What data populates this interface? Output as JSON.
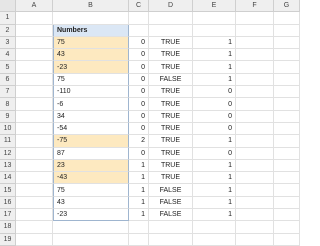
{
  "columns": [
    "A",
    "B",
    "C",
    "D",
    "E",
    "F",
    "G"
  ],
  "table_header": "Numbers",
  "rows": [
    {
      "num": "1",
      "b": "",
      "c": "",
      "d": "",
      "e": "",
      "hl": false
    },
    {
      "num": "2",
      "b": "Numbers",
      "c": "",
      "d": "",
      "e": "",
      "hl": false,
      "header": true
    },
    {
      "num": "3",
      "b": "75",
      "c": "0",
      "d": "TRUE",
      "e": "1",
      "hl": true
    },
    {
      "num": "4",
      "b": "43",
      "c": "0",
      "d": "TRUE",
      "e": "1",
      "hl": true
    },
    {
      "num": "5",
      "b": "-23",
      "c": "0",
      "d": "TRUE",
      "e": "1",
      "hl": true
    },
    {
      "num": "6",
      "b": "75",
      "c": "0",
      "d": "FALSE",
      "e": "1",
      "hl": false
    },
    {
      "num": "7",
      "b": "-110",
      "c": "0",
      "d": "TRUE",
      "e": "0",
      "hl": false
    },
    {
      "num": "8",
      "b": "-6",
      "c": "0",
      "d": "TRUE",
      "e": "0",
      "hl": false
    },
    {
      "num": "9",
      "b": "34",
      "c": "0",
      "d": "TRUE",
      "e": "0",
      "hl": false
    },
    {
      "num": "10",
      "b": "-54",
      "c": "0",
      "d": "TRUE",
      "e": "0",
      "hl": false
    },
    {
      "num": "11",
      "b": "-75",
      "c": "2",
      "d": "TRUE",
      "e": "1",
      "hl": true
    },
    {
      "num": "12",
      "b": "87",
      "c": "0",
      "d": "TRUE",
      "e": "0",
      "hl": false
    },
    {
      "num": "13",
      "b": "23",
      "c": "1",
      "d": "TRUE",
      "e": "1",
      "hl": true
    },
    {
      "num": "14",
      "b": "-43",
      "c": "1",
      "d": "TRUE",
      "e": "1",
      "hl": true
    },
    {
      "num": "15",
      "b": "75",
      "c": "1",
      "d": "FALSE",
      "e": "1",
      "hl": false
    },
    {
      "num": "16",
      "b": "43",
      "c": "1",
      "d": "FALSE",
      "e": "1",
      "hl": false
    },
    {
      "num": "17",
      "b": "-23",
      "c": "1",
      "d": "FALSE",
      "e": "1",
      "hl": false
    },
    {
      "num": "18",
      "b": "",
      "c": "",
      "d": "",
      "e": "",
      "hl": false
    },
    {
      "num": "19",
      "b": "",
      "c": "",
      "d": "",
      "e": "",
      "hl": false
    }
  ],
  "colors": {
    "highlight": "#fde9c0",
    "table_header_bg": "#dbe7f5",
    "header_bg": "#efefef",
    "gridline": "#e1e1e1"
  }
}
